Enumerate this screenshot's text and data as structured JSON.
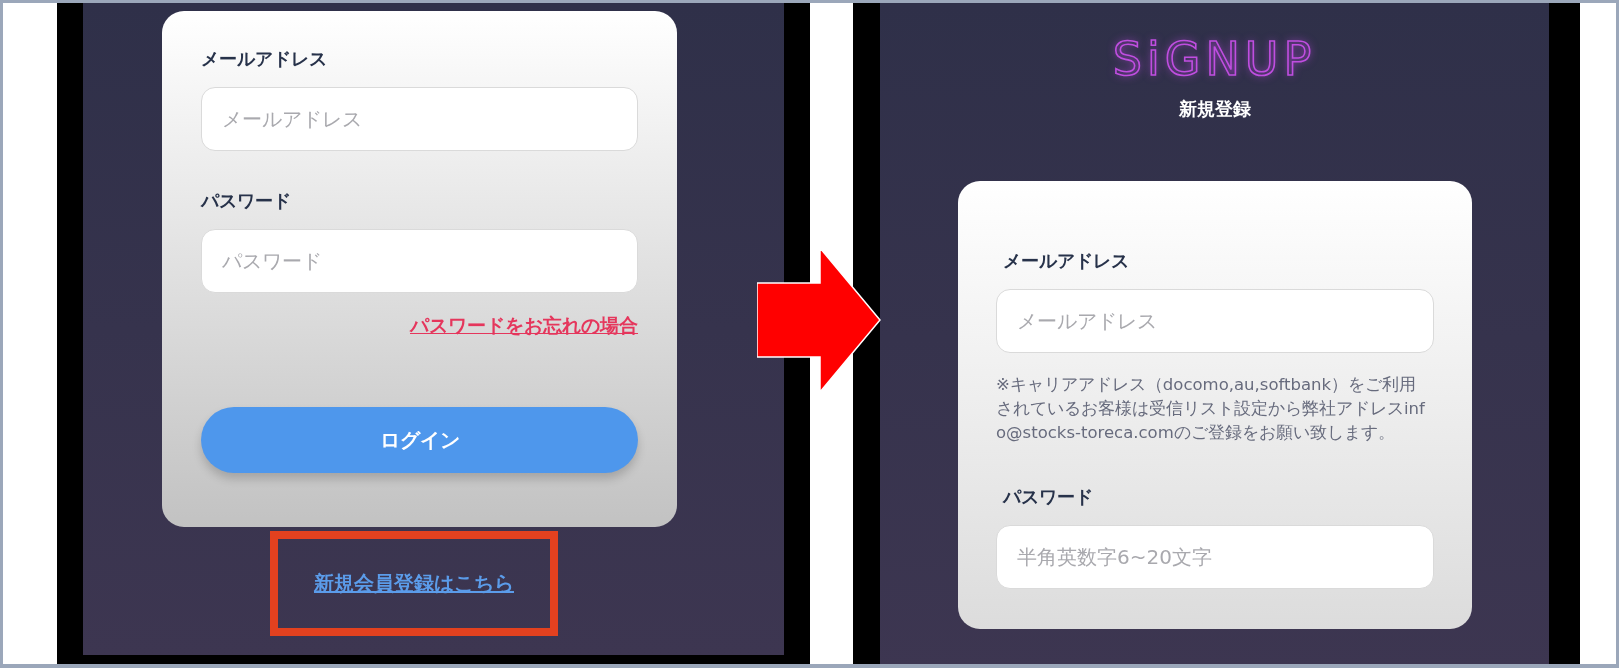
{
  "login_screen": {
    "email_label": "メールアドレス",
    "email_placeholder": "メールアドレス",
    "password_label": "パスワード",
    "password_placeholder": "パスワード",
    "forgot_link": "パスワードをお忘れの場合",
    "login_button": "ログイン",
    "signup_link": "新規会員登録はこちら",
    "signup_link_highlighted": true
  },
  "signup_screen": {
    "logo": "SiGNUP",
    "title": "新規登録",
    "email_label": "メールアドレス",
    "email_placeholder": "メールアドレス",
    "carrier_note": "※キャリアアドレス（docomo,au,softbank）をご利用されているお客様は受信リスト設定から弊社アドレスinfo@stocks-toreca.comのご登録をお願い致します。",
    "password_label": "パスワード",
    "password_placeholder": "半角英数字6~20文字"
  }
}
